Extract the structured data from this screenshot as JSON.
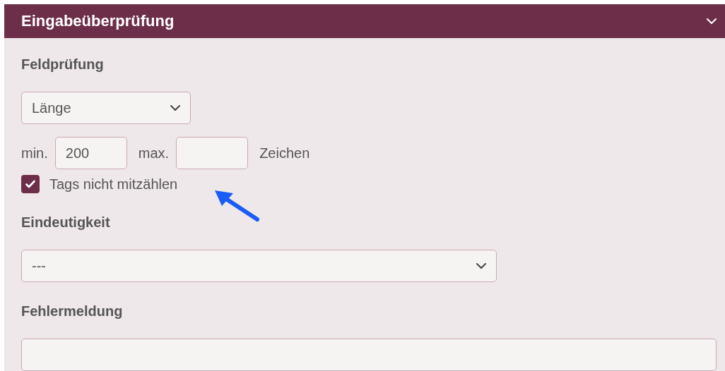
{
  "panel": {
    "title": "Eingabeüberprüfung",
    "expanded": true
  },
  "field_check": {
    "label": "Feldprüfung",
    "select_value": "Länge",
    "min_label": "min.",
    "min_value": "200",
    "max_label": "max.",
    "unit": "Zeichen",
    "checkbox": {
      "label": "Tags nicht mitzählen",
      "checked": true
    }
  },
  "uniqueness": {
    "label": "Eindeutigkeit",
    "select_value": "---"
  },
  "error_message": {
    "label": "Fehlermeldung"
  }
}
